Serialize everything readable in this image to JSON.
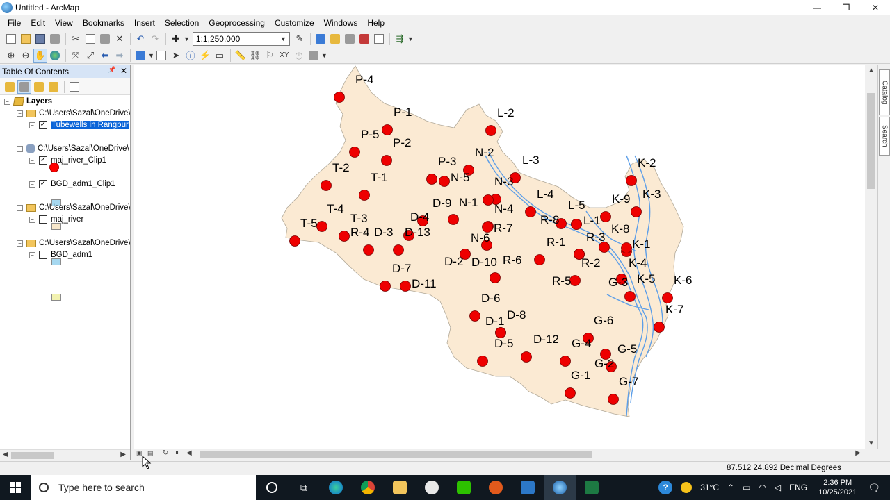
{
  "window": {
    "title": "Untitled - ArcMap",
    "minimize": "—",
    "maximize": "❐",
    "close": "✕"
  },
  "menu": [
    "File",
    "Edit",
    "View",
    "Bookmarks",
    "Insert",
    "Selection",
    "Geoprocessing",
    "Customize",
    "Windows",
    "Help"
  ],
  "toolbar": {
    "scale": "1:1,250,000"
  },
  "toc": {
    "title": "Table Of Contents",
    "pin": "📌",
    "close": "✕",
    "root": "Layers",
    "rows": [
      {
        "type": "folder",
        "label": "C:\\Users\\Sazal\\OneDrive\\"
      },
      {
        "type": "layer",
        "label": "Tubewells in Rangpur",
        "checked": true,
        "selected": true
      },
      {
        "type": "db",
        "label": "C:\\Users\\Sazal\\OneDrive\\"
      },
      {
        "type": "layer",
        "label": "maj_river_Clip1",
        "checked": true
      },
      {
        "type": "layer",
        "label": "BGD_adm1_Clip1",
        "checked": true
      },
      {
        "type": "folder",
        "label": "C:\\Users\\Sazal\\OneDrive\\"
      },
      {
        "type": "layer",
        "label": "maj_river",
        "checked": false
      },
      {
        "type": "folder",
        "label": "C:\\Users\\Sazal\\OneDrive\\"
      },
      {
        "type": "layer",
        "label": "BGD_adm1",
        "checked": false
      }
    ],
    "colors": {
      "point": "#ff0000",
      "river": "#a6d8f0",
      "region_clip": "#f8e8cc",
      "river_off": "#a6d8f0",
      "region_off": "#f2f2b0"
    }
  },
  "map": {
    "region_fill": "#fbead3",
    "river_color": "#5c9ee8",
    "point_color": "#ee0000",
    "points": [
      {
        "label": "P-4",
        "x": 0,
        "y": 0
      },
      {
        "label": "P-1",
        "x": 0,
        "y": 0
      },
      {
        "label": "P-5",
        "x": 0,
        "y": 0
      },
      {
        "label": "P-2",
        "x": 0,
        "y": 0
      },
      {
        "label": "L-2",
        "x": 0,
        "y": 0
      },
      {
        "label": "N-2",
        "x": 0,
        "y": 0
      },
      {
        "label": "L-3",
        "x": 0,
        "y": 0
      },
      {
        "label": "P-3",
        "x": 0,
        "y": 0
      },
      {
        "label": "N-5",
        "x": 0,
        "y": 0
      },
      {
        "label": "N-3",
        "x": 0,
        "y": 0
      },
      {
        "label": "T-2",
        "x": 0,
        "y": 0
      },
      {
        "label": "T-1",
        "x": 0,
        "y": 0
      },
      {
        "label": "K-2",
        "x": 0,
        "y": 0
      },
      {
        "label": "K-3",
        "x": 0,
        "y": 0
      },
      {
        "label": "K-9",
        "x": 0,
        "y": 0
      },
      {
        "label": "L-4",
        "x": 0,
        "y": 0
      },
      {
        "label": "L-5",
        "x": 0,
        "y": 0
      },
      {
        "label": "N-1",
        "x": 0,
        "y": 0
      },
      {
        "label": "D-9",
        "x": 0,
        "y": 0
      },
      {
        "label": "N-4",
        "x": 0,
        "y": 0
      },
      {
        "label": "T-4",
        "x": 0,
        "y": 0
      },
      {
        "label": "D-4",
        "x": 0,
        "y": 0
      },
      {
        "label": "R-8",
        "x": 0,
        "y": 0
      },
      {
        "label": "L-1",
        "x": 0,
        "y": 0
      },
      {
        "label": "T-5",
        "x": 0,
        "y": 0
      },
      {
        "label": "T-3",
        "x": 0,
        "y": 0
      },
      {
        "label": "R-7",
        "x": 0,
        "y": 0
      },
      {
        "label": "K-8",
        "x": 0,
        "y": 0
      },
      {
        "label": "R-4",
        "x": 0,
        "y": 0
      },
      {
        "label": "D-3",
        "x": 0,
        "y": 0
      },
      {
        "label": "D-13",
        "x": 0,
        "y": 0
      },
      {
        "label": "N-6",
        "x": 0,
        "y": 0
      },
      {
        "label": "R-3",
        "x": 0,
        "y": 0
      },
      {
        "label": "R-1",
        "x": 0,
        "y": 0
      },
      {
        "label": "K-1",
        "x": 0,
        "y": 0
      },
      {
        "label": "D-2",
        "x": 0,
        "y": 0
      },
      {
        "label": "D-10",
        "x": 0,
        "y": 0
      },
      {
        "label": "R-6",
        "x": 0,
        "y": 0
      },
      {
        "label": "R-2",
        "x": 0,
        "y": 0
      },
      {
        "label": "K-4",
        "x": 0,
        "y": 0
      },
      {
        "label": "D-7",
        "x": 0,
        "y": 0
      },
      {
        "label": "D-11",
        "x": 0,
        "y": 0
      },
      {
        "label": "R-5",
        "x": 0,
        "y": 0
      },
      {
        "label": "G-3",
        "x": 0,
        "y": 0
      },
      {
        "label": "K-5",
        "x": 0,
        "y": 0
      },
      {
        "label": "K-6",
        "x": 0,
        "y": 0
      },
      {
        "label": "D-6",
        "x": 0,
        "y": 0
      },
      {
        "label": "D-1",
        "x": 0,
        "y": 0
      },
      {
        "label": "D-8",
        "x": 0,
        "y": 0
      },
      {
        "label": "K-7",
        "x": 0,
        "y": 0
      },
      {
        "label": "G-6",
        "x": 0,
        "y": 0
      },
      {
        "label": "D-5",
        "x": 0,
        "y": 0
      },
      {
        "label": "D-12",
        "x": 0,
        "y": 0
      },
      {
        "label": "G-4",
        "x": 0,
        "y": 0
      },
      {
        "label": "G-5",
        "x": 0,
        "y": 0
      },
      {
        "label": "G-2",
        "x": 0,
        "y": 0
      },
      {
        "label": "G-1",
        "x": 0,
        "y": 0
      },
      {
        "label": "G-7",
        "x": 0,
        "y": 0
      }
    ]
  },
  "dock": {
    "catalog": "Catalog",
    "search": "Search"
  },
  "status": {
    "coordinates": "87.512  24.892 Decimal Degrees"
  },
  "taskbar": {
    "search_placeholder": "Type here to search",
    "weather": "31°C",
    "language": "ENG",
    "time": "2:36 PM",
    "date": "10/25/2021"
  }
}
